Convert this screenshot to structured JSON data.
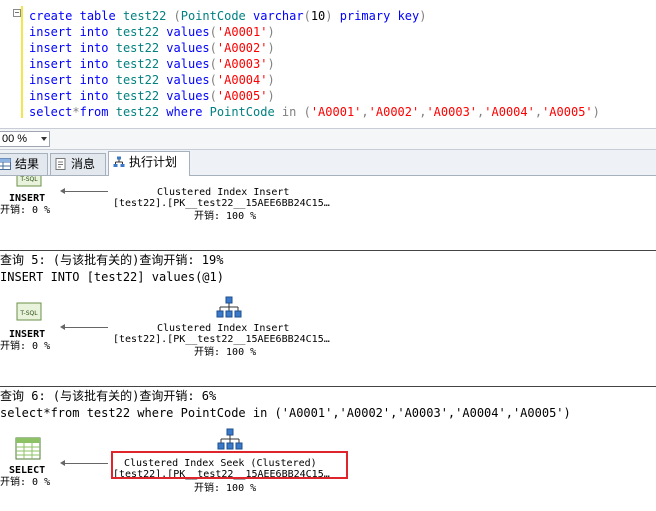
{
  "editor": {
    "lines": [
      [
        {
          "t": "create",
          "c": "kw"
        },
        {
          "t": " ",
          "c": "plain"
        },
        {
          "t": "table",
          "c": "kw"
        },
        {
          "t": " test22 ",
          "c": "id"
        },
        {
          "t": "(",
          "c": "op"
        },
        {
          "t": "PointCode",
          "c": "id"
        },
        {
          "t": " ",
          "c": "plain"
        },
        {
          "t": "varchar",
          "c": "kw"
        },
        {
          "t": "(",
          "c": "op"
        },
        {
          "t": "10",
          "c": "plain"
        },
        {
          "t": ")",
          "c": "op"
        },
        {
          "t": " ",
          "c": "plain"
        },
        {
          "t": "primary",
          "c": "kw"
        },
        {
          "t": " ",
          "c": "plain"
        },
        {
          "t": "key",
          "c": "kw"
        },
        {
          "t": ")",
          "c": "op"
        }
      ],
      [
        {
          "t": "insert",
          "c": "kw"
        },
        {
          "t": " ",
          "c": "plain"
        },
        {
          "t": "into",
          "c": "kw"
        },
        {
          "t": " test22 ",
          "c": "id"
        },
        {
          "t": "values",
          "c": "kw"
        },
        {
          "t": "(",
          "c": "op"
        },
        {
          "t": "'A0001'",
          "c": "str"
        },
        {
          "t": ")",
          "c": "op"
        }
      ],
      [
        {
          "t": "insert",
          "c": "kw"
        },
        {
          "t": " ",
          "c": "plain"
        },
        {
          "t": "into",
          "c": "kw"
        },
        {
          "t": " test22 ",
          "c": "id"
        },
        {
          "t": "values",
          "c": "kw"
        },
        {
          "t": "(",
          "c": "op"
        },
        {
          "t": "'A0002'",
          "c": "str"
        },
        {
          "t": ")",
          "c": "op"
        }
      ],
      [
        {
          "t": "insert",
          "c": "kw"
        },
        {
          "t": " ",
          "c": "plain"
        },
        {
          "t": "into",
          "c": "kw"
        },
        {
          "t": " test22 ",
          "c": "id"
        },
        {
          "t": "values",
          "c": "kw"
        },
        {
          "t": "(",
          "c": "op"
        },
        {
          "t": "'A0003'",
          "c": "str"
        },
        {
          "t": ")",
          "c": "op"
        }
      ],
      [
        {
          "t": "insert",
          "c": "kw"
        },
        {
          "t": " ",
          "c": "plain"
        },
        {
          "t": "into",
          "c": "kw"
        },
        {
          "t": " test22 ",
          "c": "id"
        },
        {
          "t": "values",
          "c": "kw"
        },
        {
          "t": "(",
          "c": "op"
        },
        {
          "t": "'A0004'",
          "c": "str"
        },
        {
          "t": ")",
          "c": "op"
        }
      ],
      [
        {
          "t": "insert",
          "c": "kw"
        },
        {
          "t": " ",
          "c": "plain"
        },
        {
          "t": "into",
          "c": "kw"
        },
        {
          "t": " test22 ",
          "c": "id"
        },
        {
          "t": "values",
          "c": "kw"
        },
        {
          "t": "(",
          "c": "op"
        },
        {
          "t": "'A0005'",
          "c": "str"
        },
        {
          "t": ")",
          "c": "op"
        }
      ],
      [
        {
          "t": "select",
          "c": "kw"
        },
        {
          "t": "*",
          "c": "op"
        },
        {
          "t": "from",
          "c": "kw"
        },
        {
          "t": " test22 ",
          "c": "id"
        },
        {
          "t": "where",
          "c": "kw"
        },
        {
          "t": " PointCode ",
          "c": "id"
        },
        {
          "t": "in",
          "c": "op"
        },
        {
          "t": " ",
          "c": "plain"
        },
        {
          "t": "(",
          "c": "op"
        },
        {
          "t": "'A0001'",
          "c": "str"
        },
        {
          "t": ",",
          "c": "op"
        },
        {
          "t": "'A0002'",
          "c": "str"
        },
        {
          "t": ",",
          "c": "op"
        },
        {
          "t": "'A0003'",
          "c": "str"
        },
        {
          "t": ",",
          "c": "op"
        },
        {
          "t": "'A0004'",
          "c": "str"
        },
        {
          "t": ",",
          "c": "op"
        },
        {
          "t": "'A0005'",
          "c": "str"
        },
        {
          "t": ")",
          "c": "op"
        }
      ]
    ]
  },
  "zoom": {
    "value": "00 %"
  },
  "tabs": [
    {
      "label": "结果",
      "icon": "grid-icon"
    },
    {
      "label": "消息",
      "icon": "messages-icon"
    },
    {
      "label": "执行计划",
      "icon": "execution-plan-icon",
      "active": true
    }
  ],
  "plan": {
    "block1": {
      "left_label": "INSERT",
      "left_cost": "开销: 0 %",
      "op_name": "Clustered Index Insert",
      "op_object": "[test22].[PK__test22__15AEE6BB24C15…",
      "op_cost": "开销: 100 %"
    },
    "query5": {
      "header": "查询 5: (与该批有关的)查询开销: 19%",
      "sql": "INSERT INTO [test22] values(@1)",
      "left_icon_text": "T-SQL",
      "left_label": "INSERT",
      "left_cost": "开销: 0 %",
      "op_name": "Clustered Index Insert",
      "op_object": "[test22].[PK__test22__15AEE6BB24C15…",
      "op_cost": "开销: 100 %"
    },
    "query6": {
      "header": "查询 6: (与该批有关的)查询开销: 6%",
      "sql": "select*from test22 where PointCode in ('A0001','A0002','A0003','A0004','A0005')",
      "left_label": "SELECT",
      "left_cost": "开销: 0 %",
      "op_name": "Clustered Index Seek (Clustered)",
      "op_object": "[test22].[PK__test22__15AEE6BB24C15…",
      "op_cost": "开销: 100 %"
    },
    "top_icon_text": "T-SQL",
    "colors": {
      "highlight": "#e0242b",
      "keyword": "#0000ff",
      "string": "#ff0000"
    }
  }
}
